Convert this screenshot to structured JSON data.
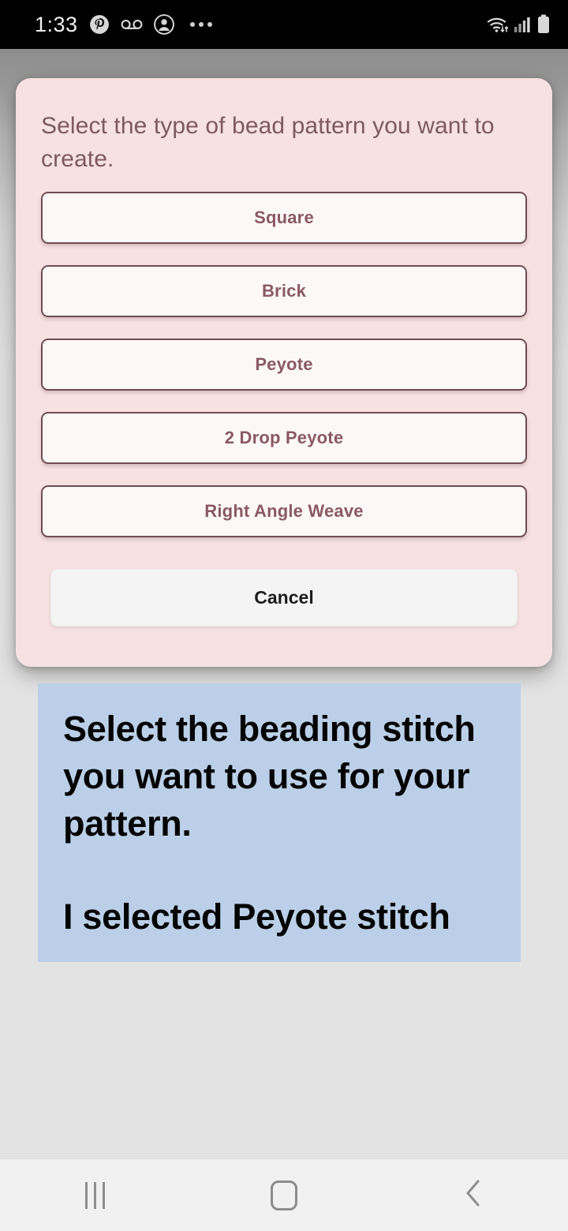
{
  "status_bar": {
    "time": "1:33",
    "left_icons": [
      "pinterest-icon",
      "voicemail-icon",
      "contact-account-icon",
      "more-notifications-icon"
    ],
    "right_icons": [
      "wifi-icon",
      "cellular-signal-icon",
      "battery-icon"
    ]
  },
  "dialog": {
    "title": "Select the type of bead pattern you want to create.",
    "options": [
      {
        "label": "Square"
      },
      {
        "label": "Brick"
      },
      {
        "label": "Peyote"
      },
      {
        "label": "2 Drop Peyote"
      },
      {
        "label": "Right Angle Weave"
      }
    ],
    "cancel_label": "Cancel"
  },
  "caption": {
    "line1": "Select the beading stitch you want to use for your pattern.",
    "line2": "I selected Peyote stitch"
  },
  "nav_bar": {
    "recents_label": "recents-icon",
    "home_label": "home-icon",
    "back_label": "back-icon"
  },
  "colors": {
    "dialog_background": "#f7e1e3",
    "dialog_title_text": "#7d5a61",
    "option_border": "#6f4d53",
    "option_fill": "#fcf8f8",
    "option_text": "#8a5963",
    "cancel_fill": "#f4f4f4",
    "cancel_text": "#1d1d1d",
    "caption_background": "#bbd0e8",
    "caption_text": "#050505",
    "screen_background": "#e3e3e3",
    "status_bar_background": "#000000",
    "nav_bar_background": "#f1f1f1"
  }
}
